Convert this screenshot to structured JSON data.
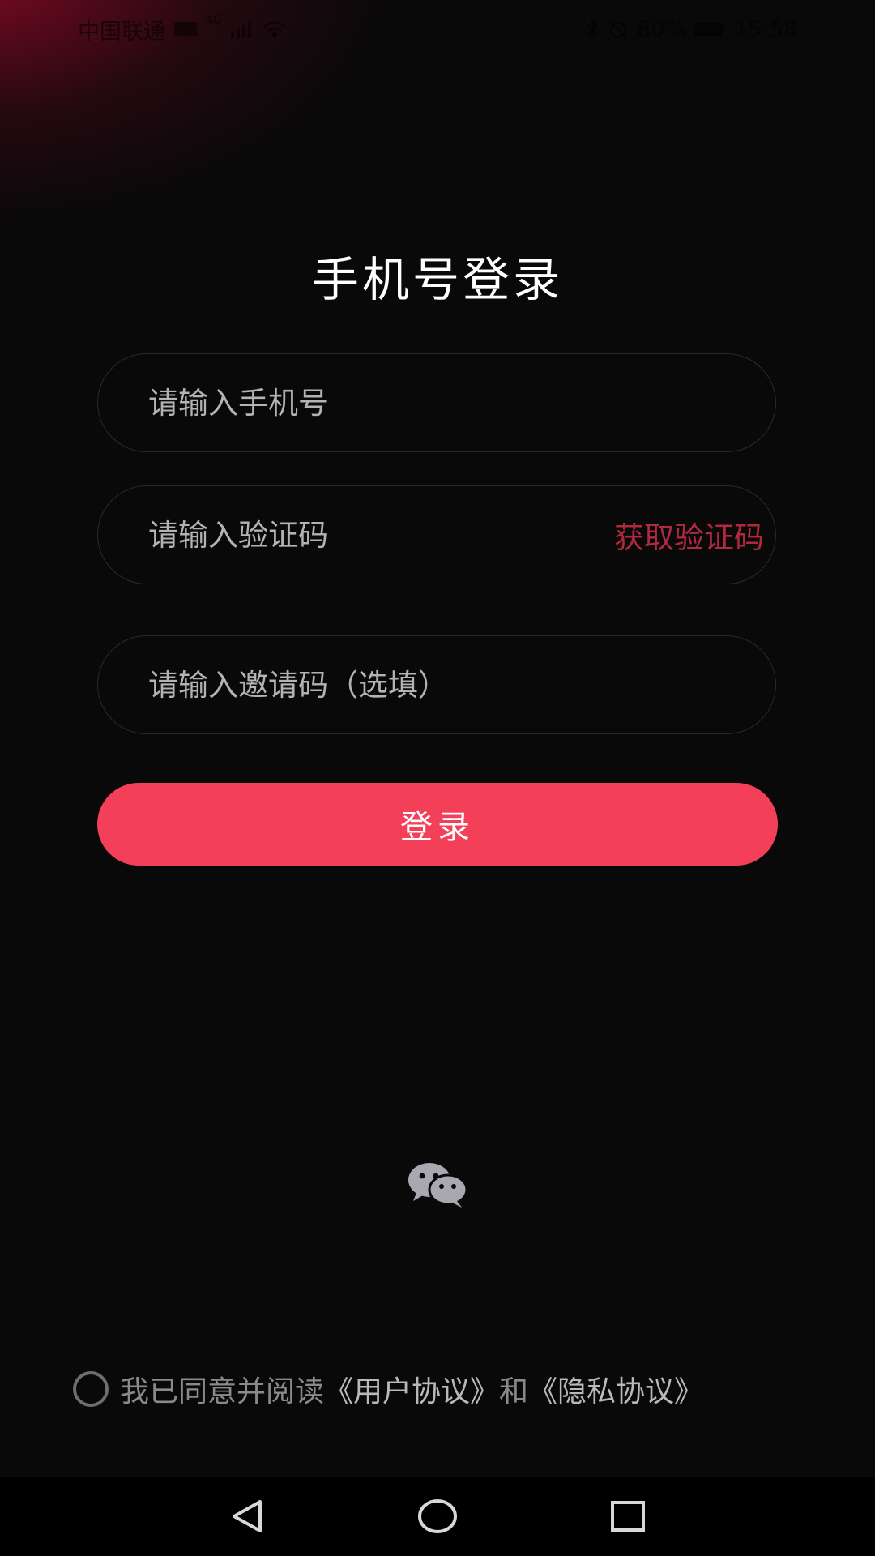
{
  "status_bar": {
    "carrier": "中国联通",
    "network": "4G",
    "battery": "80%",
    "time": "15:58"
  },
  "login": {
    "title": "手机号登录",
    "phone_placeholder": "请输入手机号",
    "code_placeholder": "请输入验证码",
    "get_code_label": "获取验证码",
    "invite_placeholder": "请输入邀请码（选填）",
    "submit_label": "登录"
  },
  "third_party": {
    "icon": "wechat-icon"
  },
  "agreement": {
    "prefix": "我已同意并阅读",
    "user_agreement": "《用户协议》",
    "conjunction": "和",
    "privacy_agreement": "《隐私协议》",
    "checked": false
  },
  "nav": {
    "back_icon": "back-triangle-icon",
    "home_icon": "home-circle-icon",
    "recents_icon": "recents-square-icon"
  },
  "colors": {
    "accent": "#f33f58",
    "get_code": "#b2283f",
    "background": "#0a090a"
  }
}
